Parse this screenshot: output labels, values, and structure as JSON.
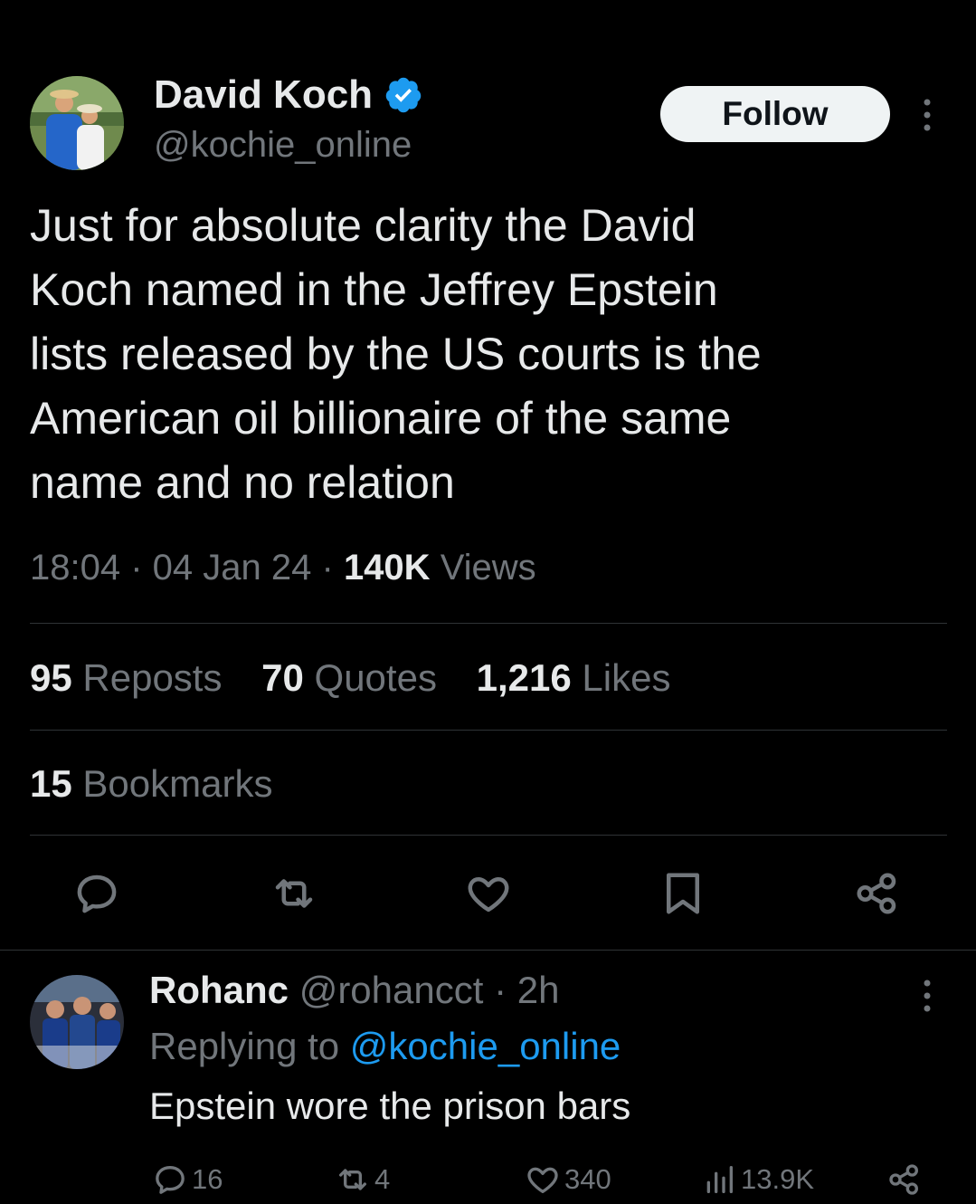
{
  "tweet": {
    "author_name": "David Koch",
    "author_handle": "@kochie_online",
    "follow_label": "Follow",
    "text": "Just for absolute clarity the David\nKoch named in the Jeffrey Epstein\nlists released by the US courts is the\nAmerican oil billionaire of the same\nname and no relation",
    "time": "18:04",
    "date": "04 Jan 24",
    "views_count": "140K",
    "views_label": "Views",
    "reposts_count": "95",
    "reposts_label": "Reposts",
    "quotes_count": "70",
    "quotes_label": "Quotes",
    "likes_count": "1,216",
    "likes_label": "Likes",
    "bookmarks_count": "15",
    "bookmarks_label": "Bookmarks",
    "actions": [
      "reply-icon",
      "repost-icon",
      "like-icon",
      "bookmark-icon",
      "share-icon"
    ]
  },
  "reply": {
    "author_name": "Rohanc",
    "author_handle": "@rohancct",
    "age": "2h",
    "replying_label": "Replying to",
    "replying_to": "@kochie_online",
    "text": "Epstein wore the prison bars",
    "reply_count": "16",
    "repost_count": "4",
    "like_count": "340",
    "views_count": "13.9K"
  },
  "colors": {
    "background": "#000000",
    "text": "#e7e9ea",
    "muted": "#71767b",
    "link": "#1d9bf0",
    "divider": "#2f3336",
    "verified": "#1d9bf0"
  }
}
